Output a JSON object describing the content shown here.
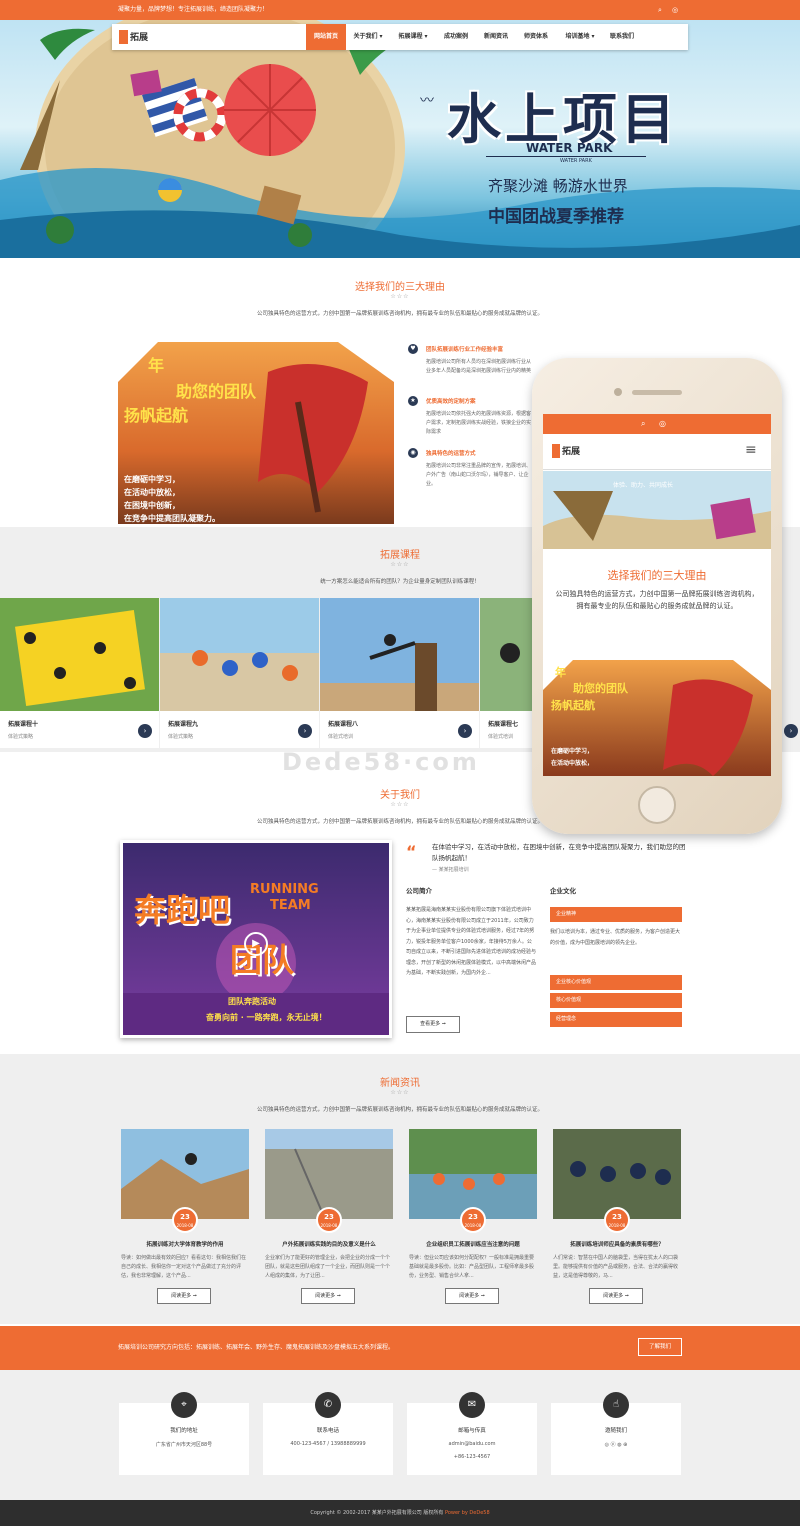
{
  "topbar": {
    "slogan": "凝聚力量，品牌梦想！专注拓展训练，缔造团队凝聚力！"
  },
  "logo": {
    "text": "拓展"
  },
  "nav": [
    "网站首页",
    "关于我们 ▾",
    "拓展课程 ▾",
    "成功案例",
    "新闻资讯",
    "师资体系",
    "培训基地 ▾",
    "联系我们"
  ],
  "hero": {
    "title": "水上项目",
    "en": "WATER PARK",
    "en_small": "WATER PARK",
    "line1": "齐聚沙滩    畅游水世界",
    "line2": "中国团战夏季推荐"
  },
  "reasons": {
    "title": "选择我们的三大理由",
    "stars": "☆☆☆",
    "desc": "公司独具特色的运营方式，力创中国第一品牌拓展训练咨询机构，拥有最专业的队伍和最贴心的服务成就品牌的认证。",
    "banner": {
      "line1": "年",
      "line2": "助您的团队",
      "line3": "扬帆起航",
      "sub1": "在磨砺中学习，",
      "sub2": "在活动中放松，",
      "sub3": "在困境中创新，",
      "sub4": "在竞争中提高团队凝聚力。"
    },
    "items": [
      {
        "title": "团队拓展训练行业工作经验丰富",
        "desc": "拓展培训公司所有人员均在深圳拓展训练行业从业多年人员配备均是深圳拓展训练行业内的精英"
      },
      {
        "title": "优质高效的定制方案",
        "desc": "拓展培训公司依托强大的拓展训练资源，根据客户需求，定制拓展训练实战经验，铁狼企业的实际需求"
      },
      {
        "title": "独具特色的运营方式",
        "desc": "拓展培训公司非常注重品牌的宣传，拓展培训、户外广告（南山蛇口沃尔玛），铺导客户、让企业。"
      }
    ]
  },
  "courses": {
    "title": "拓展课程",
    "stars": "☆☆☆",
    "desc": "统一方案怎么能适合所有的团队？为企业量身定制团队训练课程！",
    "items": [
      {
        "title": "拓展课程十",
        "sub": "体验式策略"
      },
      {
        "title": "拓展课程九",
        "sub": "体验式策略"
      },
      {
        "title": "拓展课程八",
        "sub": "体验式培训"
      },
      {
        "title": "拓展课程七",
        "sub": "体验式培训"
      }
    ],
    "next_arrow": "›"
  },
  "about": {
    "title": "关于我们",
    "stars": "☆☆☆",
    "desc": "公司独具特色的运营方式，力创中国第一品牌拓展训练咨询机构，拥有最专业的队伍和最贴心的服务成就品牌的认证。",
    "video": {
      "cn1": "奔跑吧",
      "cn2": "团队",
      "en1": "RUNNING",
      "en2": "TEAM",
      "b1": "团队奔跑活动",
      "b2": "奋勇向前 · 一路奔跑，永无止境！"
    },
    "quote": "在体验中学习，在活动中放松，在困境中创新，在竞争中提高团队凝聚力，我们助您的团队扬帆起航！",
    "quote_src": "— 某某拓展培训",
    "intro_title": "公司简介",
    "intro": "某某拓展是海南某某实业股份有限公司旗下体验式培训中心，海南某某实业股份有限公司成立于2011年，公司致力于为企事业单位提供专业的体验式培训服务，经过7年的努力，锐投年服务单位客户1000余家，年接待5万余人。公司自成立以来，不断引进国际先进体验式培训的成功经验与理念，开创了新型的休闲拓展体验模式，以中高端休闲产品为基础，不断实践创新，为国内外企...",
    "more": "查看更多 ➞",
    "culture_title": "企业文化",
    "culture_tabs": [
      "企业精神",
      "企业核心价值观",
      "核心价值观",
      "经营理念"
    ],
    "culture_text": "我们以培训为本，通过专业、优质的服务，为客户创造更大的价值，成为中国拓展培训的领先企业。"
  },
  "news": {
    "title": "新闻资讯",
    "stars": "☆☆☆",
    "desc": "公司独具特色的运营方式，力创中国第一品牌拓展训练咨询机构，拥有最专业的队伍和最贴心的服务成就品牌的认证。",
    "items": [
      {
        "day": "23",
        "ym": "2018-08",
        "title": "拓展训练对大学体育教学的作用",
        "desc": "导读：如何做出最有效的回应？看看这句：我相信我们在自己的成长、我相信你一定对这个产品做过了充分的评估，我也非常理解，这个产品..."
      },
      {
        "day": "23",
        "ym": "2018-08",
        "title": "户外拓展训练实践的目的及意义是什么",
        "desc": "企业家们为了能更好的管理企业，会把企业的分成一个个团队，就是这些团队组成了一个企业，而团队则是一个个人组成的集体，为了让团..."
      },
      {
        "day": "23",
        "ym": "2018-08",
        "title": "企业组织员工拓展训练应当注意的问题",
        "desc": "导读：但业公司应该如何分配配权？一般标准是拥最重要基础就是最多股份。比如：产品型团队，工程师拿最多股份，业务型、销售合伙人拿..."
      },
      {
        "day": "23",
        "ym": "2018-08",
        "title": "拓展训练培训师应具备的素质有哪些？",
        "desc": "人们常说：智慧在中国人的脑袋里，当得在犹太人的口袋里。能够提供有价值的产品或服务，合法、合法的赢得收益，这是值得尊敬的，马..."
      }
    ],
    "more": "阅读更多 ➞"
  },
  "banner": {
    "text": "拓展培训公司研究方向包括：拓展训练、拓展年会、野外生存、魔鬼拓展训练及沙盘模拟五大系列课程。",
    "button": "了解我们"
  },
  "contacts": [
    {
      "icon": "map-pin-icon",
      "glyph": "⌖",
      "title": "我们的地址",
      "l1": "广东省广州市天河区88号",
      "l2": ""
    },
    {
      "icon": "phone-icon",
      "glyph": "✆",
      "title": "联系电话",
      "l1": "400-123-4567 / 13988889999",
      "l2": ""
    },
    {
      "icon": "mail-icon",
      "glyph": "✉",
      "title": "邮箱与传真",
      "l1": "admin@baidu.com",
      "l2": "+86-123-4567"
    },
    {
      "icon": "thumb-icon",
      "glyph": "☝",
      "title": "邀随我们",
      "l1": "◎  ⓟ  ◍  ⊕",
      "l2": ""
    }
  ],
  "footer": {
    "copyright": "Copyright © 2002-2017 某某户外拓展有限公司 版权所有",
    "power_label": "Power by",
    "power_link": "DeDe58"
  },
  "phone": {
    "banner_text": "体验、助力、共同成长",
    "title": "选择我们的三大理由",
    "desc": "公司独具特色的运营方式，力创中国第一品牌拓展训练咨询机构，拥有最专业的队伍和最贴心的服务成就品牌的认证。",
    "img_line1": "年",
    "img_line2": "助您的团队",
    "img_line3": "扬帆起航",
    "img_sub1": "在磨砺中学习，",
    "img_sub2": "在活动中放松，"
  },
  "watermark": "Dede58·com",
  "colors": {
    "accent": "#ee6c33",
    "navy": "#2b3a55",
    "grey_bg": "#efefef",
    "footer": "#2e2e2e"
  }
}
